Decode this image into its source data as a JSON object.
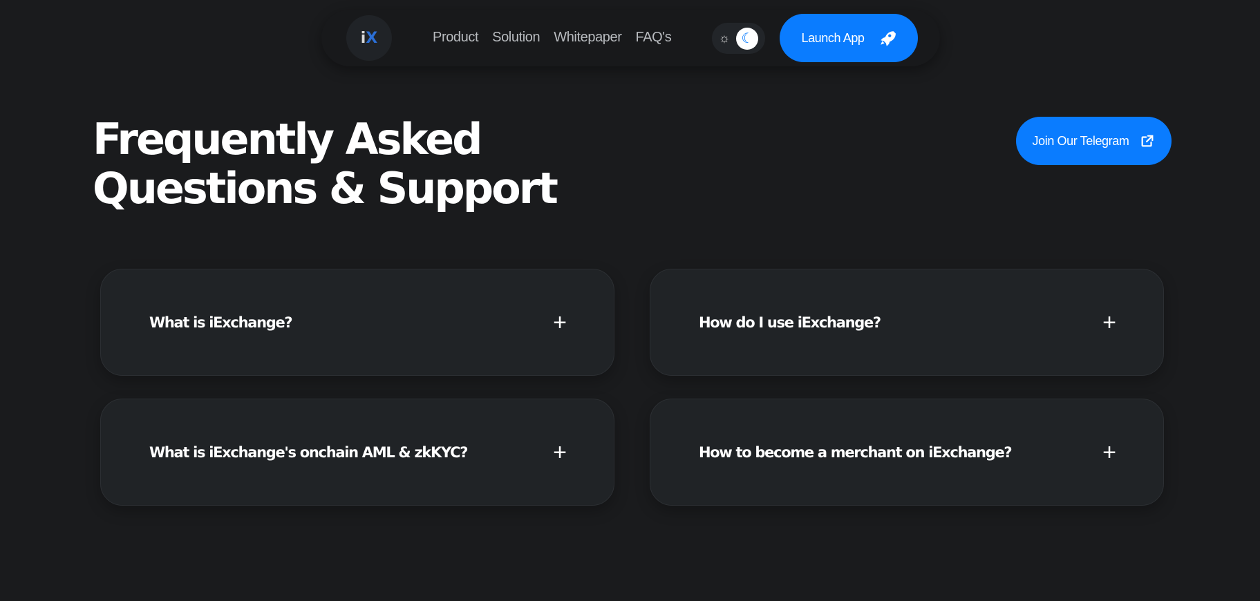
{
  "nav": {
    "logo": "iX",
    "links": [
      "Product",
      "Solution",
      "Whitepaper",
      "FAQ's"
    ],
    "theme": {
      "light_icon": "sun-icon",
      "dark_icon": "moon-icon",
      "selected": "dark"
    },
    "launch_label": "Launch App",
    "launch_icon": "rocket-icon"
  },
  "hero": {
    "title_line1": "Frequently Asked",
    "title_line2": "Questions & Support",
    "telegram_label": "Join Our Telegram",
    "telegram_icon": "external-link-icon"
  },
  "faq": [
    {
      "question": "What is iExchange?"
    },
    {
      "question": "How do I use iExchange?"
    },
    {
      "question": "What is iExchange's onchain AML & zkKYC?"
    },
    {
      "question": "How to become a merchant on iExchange?"
    }
  ],
  "colors": {
    "accent": "#0a7cff",
    "background": "#1a1b1d",
    "card": "#202326"
  }
}
